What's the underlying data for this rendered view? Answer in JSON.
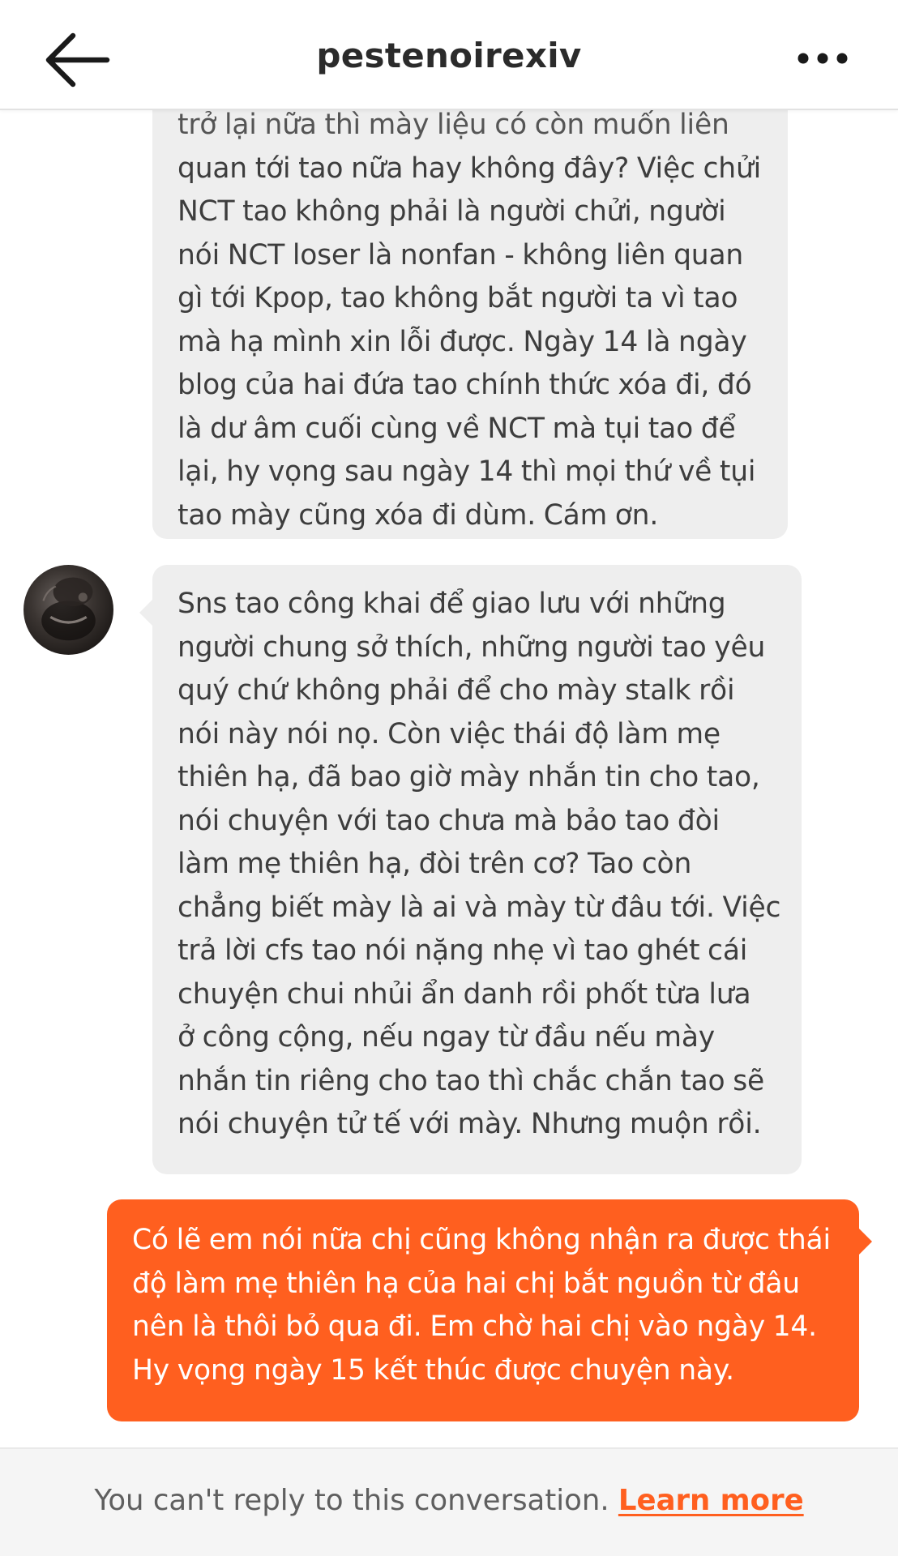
{
  "header": {
    "title": "pestenoirexiv",
    "back_icon": "arrow-left-icon",
    "more_icon": "more-horizontal-icon"
  },
  "colors": {
    "accent": "#ff5f1f",
    "received_bubble": "#eeeeee",
    "received_text": "#3d3d3d",
    "sent_text": "#ffffff",
    "footer_bg": "#f5f5f5"
  },
  "messages": [
    {
      "direction": "received",
      "lines": [
        "trở lại nữa thì mày liệu có còn muốn liên",
        "quan tới tao nữa hay không đây? Việc chửi",
        "NCT tao không phải là người chửi, người",
        "nói NCT loser là nonfan - không liên quan",
        "gì tới Kpop, tao không bắt người ta vì tao",
        "mà hạ mình xin lỗi được. Ngày 14 là ngày",
        "blog của hai đứa tao chính thức xóa đi, đó",
        "là dư âm cuối cùng về NCT mà tụi tao để",
        "lại, hy vọng sau ngày 14 thì mọi thứ về tụi",
        "tao mày cũng xóa đi dùm. Cám ơn."
      ]
    },
    {
      "direction": "received",
      "lines": [
        "Sns tao công khai để giao lưu với những",
        "người chung sở thích, những người tao yêu",
        "quý chứ không phải để cho mày stalk rồi",
        "nói này nói nọ. Còn việc thái độ làm mẹ",
        "thiên hạ, đã bao giờ mày nhắn tin cho tao,",
        "nói chuyện với tao chưa mà bảo tao đòi",
        "làm mẹ thiên hạ, đòi trên cơ? Tao còn",
        "chẳng biết mày là ai và mày từ đâu tới. Việc",
        "trả lời cfs tao nói nặng nhẹ vì tao ghét cái",
        "chuyện chui nhủi ẩn danh rồi phốt từa lưa",
        "ở công cộng, nếu ngay từ đầu nếu mày",
        "nhắn tin riêng cho tao thì chắc chắn tao sẽ",
        "nói chuyện tử tế với mày. Nhưng muộn rồi."
      ]
    },
    {
      "direction": "sent",
      "lines": [
        "Có lẽ em nói nữa chị cũng không nhận ra được thái",
        "độ làm mẹ thiên hạ của hai chị bắt nguồn từ đâu",
        "nên là thôi bỏ qua đi. Em chờ hai chị vào ngày 14.",
        "Hy vọng ngày 15 kết thúc  được chuyện này."
      ]
    }
  ],
  "footer": {
    "notice": "You can't reply to this conversation. ",
    "link_label": "Learn more"
  }
}
